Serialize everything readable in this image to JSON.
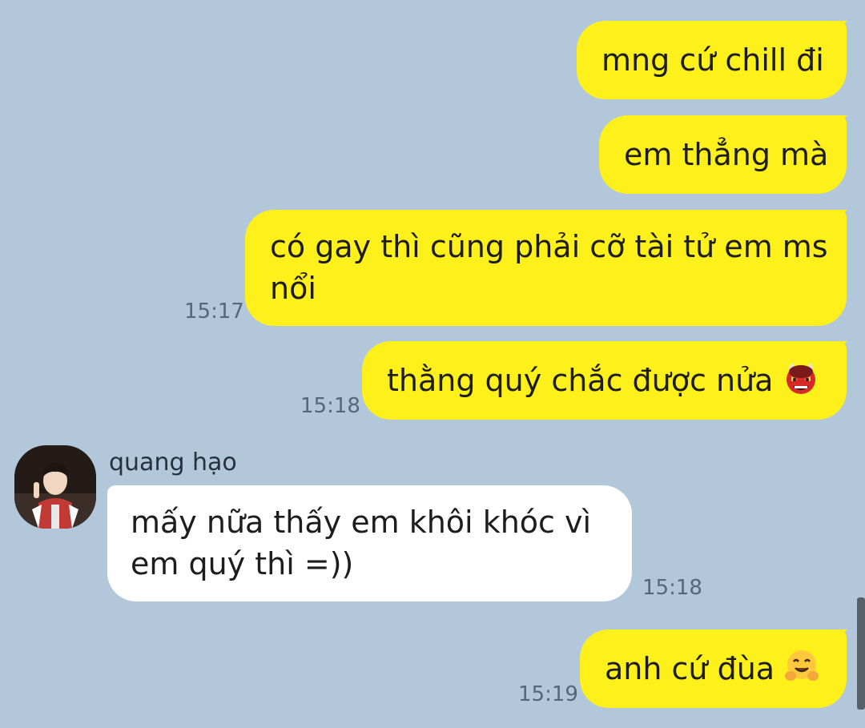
{
  "messages": [
    {
      "text": "mng cứ chill đi",
      "time": "",
      "direction": "out"
    },
    {
      "text": "em thẳng mà",
      "time": "",
      "direction": "out"
    },
    {
      "line1": "có gay thì cũng phải cỡ tài tử em ms",
      "line2": "nổi",
      "time": "15:17",
      "direction": "out"
    },
    {
      "text": "thằng quý chắc được nửa",
      "emoji": "ogre-emoji",
      "time": "15:18",
      "direction": "out"
    },
    {
      "sender": "quang hạo",
      "line1": "mấy nữa thấy em khôi khóc vì",
      "line2": "em quý thì =))",
      "time": "15:18",
      "direction": "in"
    },
    {
      "text": "anh cứ đùa",
      "emoji": "hugging-face-emoji",
      "time": "15:19",
      "direction": "out"
    }
  ],
  "colors": {
    "background": "#b2c7da",
    "outgoing_bubble": "#fef01b",
    "incoming_bubble": "#ffffff",
    "timestamp": "#55677a"
  }
}
